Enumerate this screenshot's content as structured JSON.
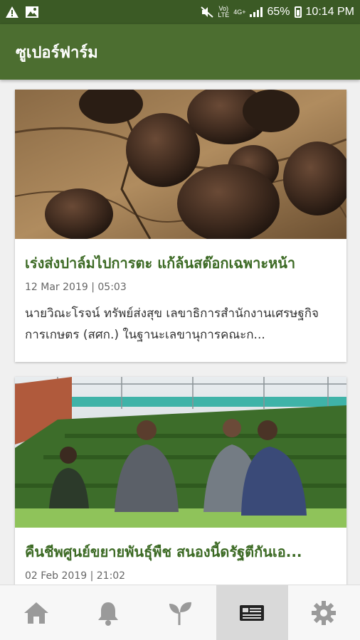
{
  "status_bar": {
    "left_icons": [
      "warning-icon",
      "image-icon"
    ],
    "volte_top": "Vo)",
    "volte_bottom": "LTE",
    "net_top": "4G+",
    "battery": "65%",
    "time": "10:14 PM"
  },
  "app_bar": {
    "title": "ซูเปอร์ฟาร์ม"
  },
  "articles": [
    {
      "image": "truffles-photo",
      "title": "เร่งส่งปาล์มไปการตะ แก้ล้นสต๊อกเฉพาะหน้า",
      "date": "12 Mar 2019 | 05:03",
      "excerpt": "นายวิณะโรจน์ ทรัพย์ส่งสุข เลขาธิการสำนักงานเศรษฐกิจการเกษตร (สศก.) ในฐานะเลขานุการคณะก..."
    },
    {
      "image": "greenhouse-photo",
      "title": "คืนชีพศูนย์ขยายพันธุ์พืช สนองนี้ดรัฐตีกันเอ...",
      "date": "02 Feb 2019 | 21:02"
    }
  ],
  "bottom_nav": {
    "items": [
      "home-icon",
      "bell-icon",
      "sprout-icon",
      "news-icon",
      "gear-icon"
    ],
    "active": "news-icon"
  },
  "colors": {
    "status_bar": "#3b5a25",
    "app_bar": "#4c6e30",
    "title_green": "#3c6a24"
  }
}
